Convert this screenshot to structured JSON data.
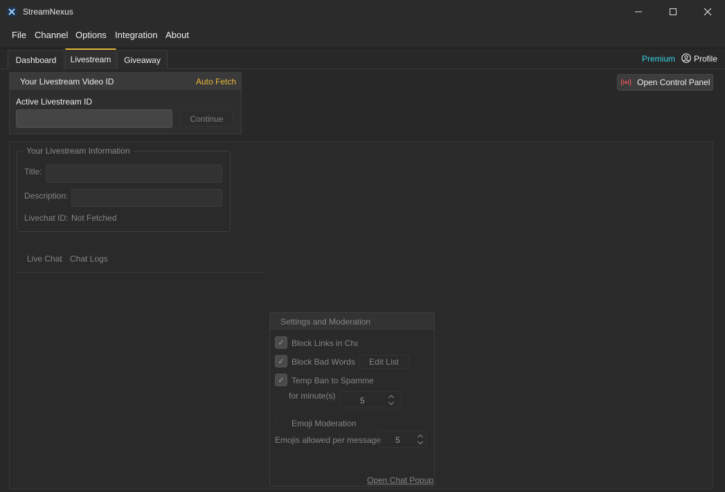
{
  "app": {
    "title": "StreamNexus"
  },
  "window_controls": {
    "minimize": "—",
    "maximize": "☐",
    "close": "✕"
  },
  "menu": {
    "file": "File",
    "channel": "Channel",
    "options": "Options",
    "integration": "Integration",
    "about": "About"
  },
  "tabs": {
    "dashboard": "Dashboard",
    "livestream": "Livestream",
    "giveaway": "Giveaway",
    "active": "Livestream"
  },
  "header": {
    "premium": "Premium",
    "profile": "Profile"
  },
  "video_panel": {
    "title": "Your Livestream Video ID",
    "auto_fetch": "Auto Fetch",
    "active_id_label": "Active Livestream ID",
    "active_id_value": "",
    "continue": "Continue"
  },
  "control_panel_button": "Open Control Panel",
  "info_group": {
    "title": "Your Livestream Information",
    "title_label": "Title:",
    "description_label": "Description:",
    "livechat_label": "Livechat ID:",
    "livechat_value": "Not Fetched"
  },
  "chat_tabs": {
    "live_chat": "Live Chat",
    "chat_logs": "Chat Logs"
  },
  "settings": {
    "title": "Settings and Moderation",
    "block_links": "Block Links in Chat",
    "block_links_checked": true,
    "block_bad_words": "Block Bad Words",
    "block_bad_words_checked": true,
    "edit_list": "Edit List",
    "temp_ban": "Temp Ban to Spammers",
    "temp_ban_checked": true,
    "for_minutes": "for minute(s)",
    "minutes_value": "5",
    "emoji_moderation": "Emoji Moderation",
    "emoji_moderation_checked": false,
    "emojis_allowed_label": "Emojis allowed per message",
    "emojis_allowed_value": "5",
    "open_chat_popup": "Open Chat Popup"
  },
  "colors": {
    "accent": "#e8b93a",
    "premium": "#3ad6e8",
    "background": "#282828",
    "control_panel_icon": "#e05555"
  }
}
